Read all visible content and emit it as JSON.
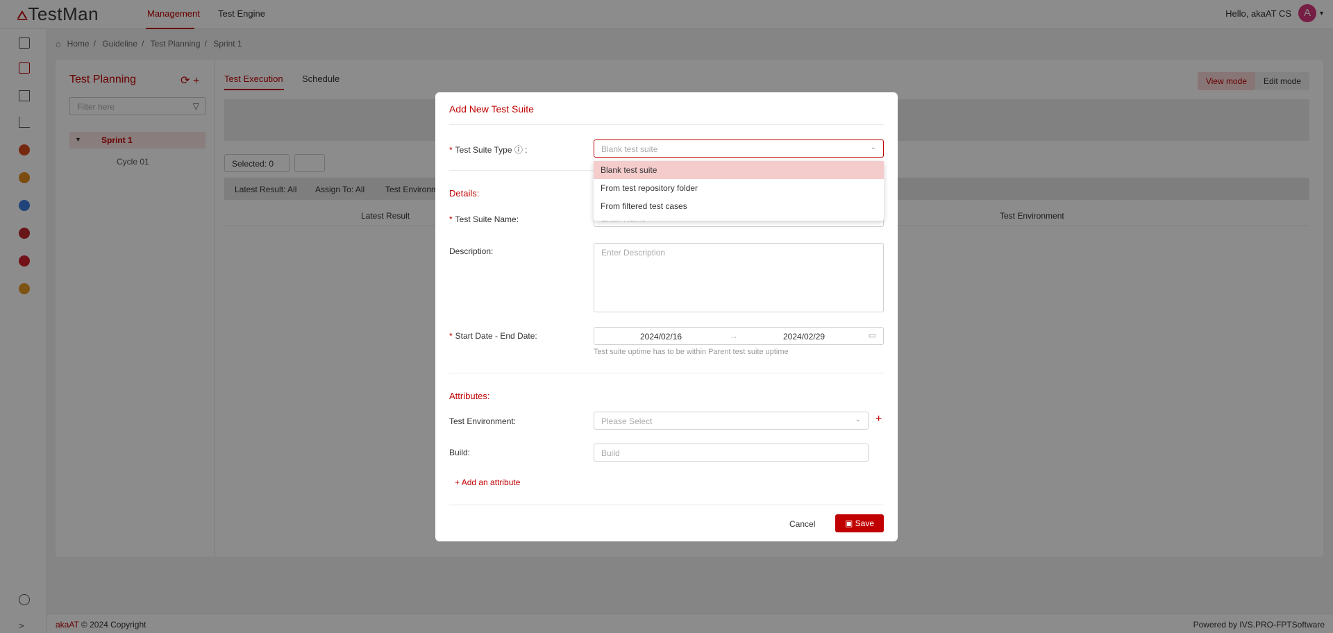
{
  "header": {
    "logo": "TestMan",
    "nav": [
      "Management",
      "Test Engine"
    ],
    "greeting": "Hello, akaAT CS",
    "avatar_letter": "A"
  },
  "breadcrumb": [
    "Home",
    "Guideline",
    "Test Planning",
    "Sprint 1"
  ],
  "planning": {
    "title": "Test Planning",
    "filter_placeholder": "Filter here",
    "tree": [
      {
        "label": "Sprint 1"
      },
      {
        "label": "Cycle 01"
      }
    ]
  },
  "tabs": [
    "Test Execution",
    "Schedule"
  ],
  "modes": [
    "View mode",
    "Edit mode"
  ],
  "toolbar": {
    "selected": "Selected: 0",
    "filters": [
      "Latest Result: All",
      "Assign To: All",
      "Test Environm"
    ]
  },
  "table": {
    "columns": [
      "Latest Result",
      "Test Environment"
    ]
  },
  "footer": {
    "brand": "akaAT",
    "copyright": "© 2024 Copyright",
    "powered": "Powered by IVS.PRO-FPTSoftware"
  },
  "modal": {
    "title": "Add New Test Suite",
    "type_label": "Test Suite Type",
    "type_value": "Blank test suite",
    "dropdown_options": [
      "Blank test suite",
      "From test repository folder",
      "From filtered test cases"
    ],
    "details_heading": "Details:",
    "name_label": "Test Suite Name:",
    "name_placeholder": "Enter Name",
    "description_label": "Description:",
    "description_placeholder": "Enter Description",
    "date_label": "Start Date - End Date:",
    "start_date": "2024/02/16",
    "end_date": "2024/02/29",
    "date_hint": "Test suite uptime has to be within Parent test suite uptime",
    "attributes_heading": "Attributes:",
    "env_label": "Test Environment:",
    "env_placeholder": "Please Select",
    "build_label": "Build:",
    "build_placeholder": "Build",
    "add_attribute": "Add an attribute",
    "cancel": "Cancel",
    "save": "Save"
  },
  "colors": {
    "accent": "#c00000"
  }
}
